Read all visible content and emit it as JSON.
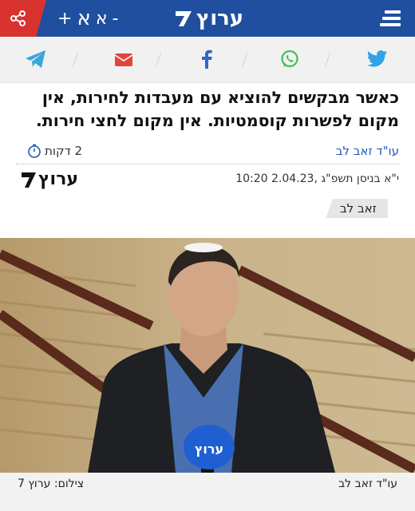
{
  "header": {
    "font_plus": "+",
    "font_big": "א",
    "font_small": "א",
    "font_minus": "-",
    "logo_text": "ערוץ"
  },
  "share_bar": {
    "icons": [
      "telegram-icon",
      "email-icon",
      "facebook-icon",
      "whatsapp-icon",
      "twitter-icon"
    ]
  },
  "article": {
    "headline": "כאשר מבקשים להוציא עם מעבדות לחירות, אין מקום לפשרות קוסמטיות. אין מקום לחצי חירות.",
    "author": "עו\"ד זאב לב",
    "read_time": "2 דקות",
    "date": "י\"א בניסן תשפ\"ג  ,2.04.23  10:20",
    "publisher_logo": "ערוץ",
    "tag": "זאב לב"
  },
  "photo": {
    "mic_label": "ערוץ",
    "caption_author": "עו\"ד זאב לב",
    "caption_credit": "צילום: ערוץ 7"
  },
  "colors": {
    "header_blue": "#1f4f9e",
    "share_red": "#d9332f",
    "link_blue": "#1f58b8"
  }
}
